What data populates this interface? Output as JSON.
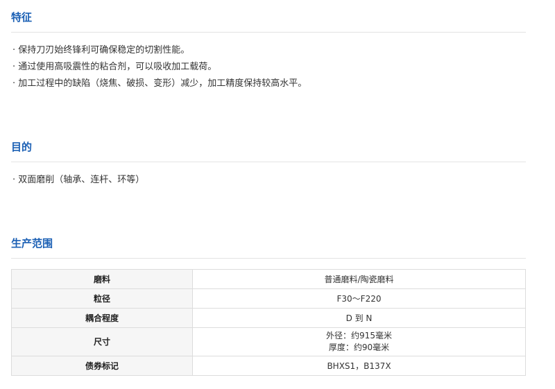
{
  "features": {
    "title": "特征",
    "items": [
      "· 保持刀刃始终锋利可确保稳定的切割性能。",
      "· 通过使用高吸震性的粘合剂，可以吸收加工载荷。",
      "· 加工过程中的缺陷（烧焦、破损、变形）减少，加工精度保持较高水平。"
    ]
  },
  "purpose": {
    "title": "目的",
    "items": [
      "· 双面磨削（轴承、连杆、环等）"
    ]
  },
  "range": {
    "title": "生产范围",
    "rows": [
      {
        "label": "磨料",
        "values": [
          "普通磨料/陶瓷磨料"
        ]
      },
      {
        "label": "粒径",
        "values": [
          "F30～F220"
        ]
      },
      {
        "label": "耦合程度",
        "values": [
          "D 到 N"
        ]
      },
      {
        "label": "尺寸",
        "values": [
          "外径：约915毫米",
          "厚度：约90毫米"
        ]
      },
      {
        "label": "债券标记",
        "values": [
          "BHXS1，B137X"
        ]
      }
    ]
  }
}
